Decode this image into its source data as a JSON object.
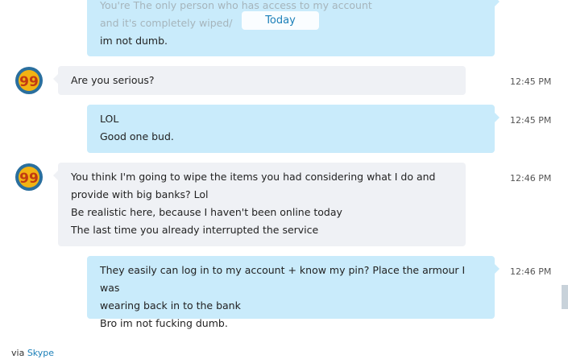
{
  "divider": {
    "label": "Today"
  },
  "messages": [
    {
      "lines": [
        "You're The only person who has access to my account",
        "and it's completely wiped/",
        "im not dumb."
      ]
    },
    {
      "lines": [
        "Are you serious?"
      ],
      "time": "12:45 PM"
    },
    {
      "lines": [
        "LOL",
        "Good one bud."
      ],
      "time": "12:45 PM"
    },
    {
      "lines": [
        "You think I'm going to wipe the items you had considering what I do and",
        "provide with big banks? Lol",
        "Be realistic here, because I haven't been online today",
        "The last time you already interrupted the service"
      ],
      "time": "12:46 PM"
    },
    {
      "lines": [
        "They easily can log in to my account + know my pin? Place the armour I was",
        "wearing back in to the bank",
        "Bro im not fucking dumb."
      ],
      "time": "12:46 PM"
    }
  ],
  "avatar": {
    "text": "99",
    "icon": "avatar-99-icon",
    "colors": {
      "ring": "#2a6f9e",
      "fill": "#f2b313",
      "text": "#c23a12"
    }
  },
  "footer": {
    "via_label": "via",
    "link_label": "Skype"
  },
  "colors": {
    "incoming": "#eff1f5",
    "outgoing": "#c9ebfb",
    "link": "#1b7fb8"
  }
}
